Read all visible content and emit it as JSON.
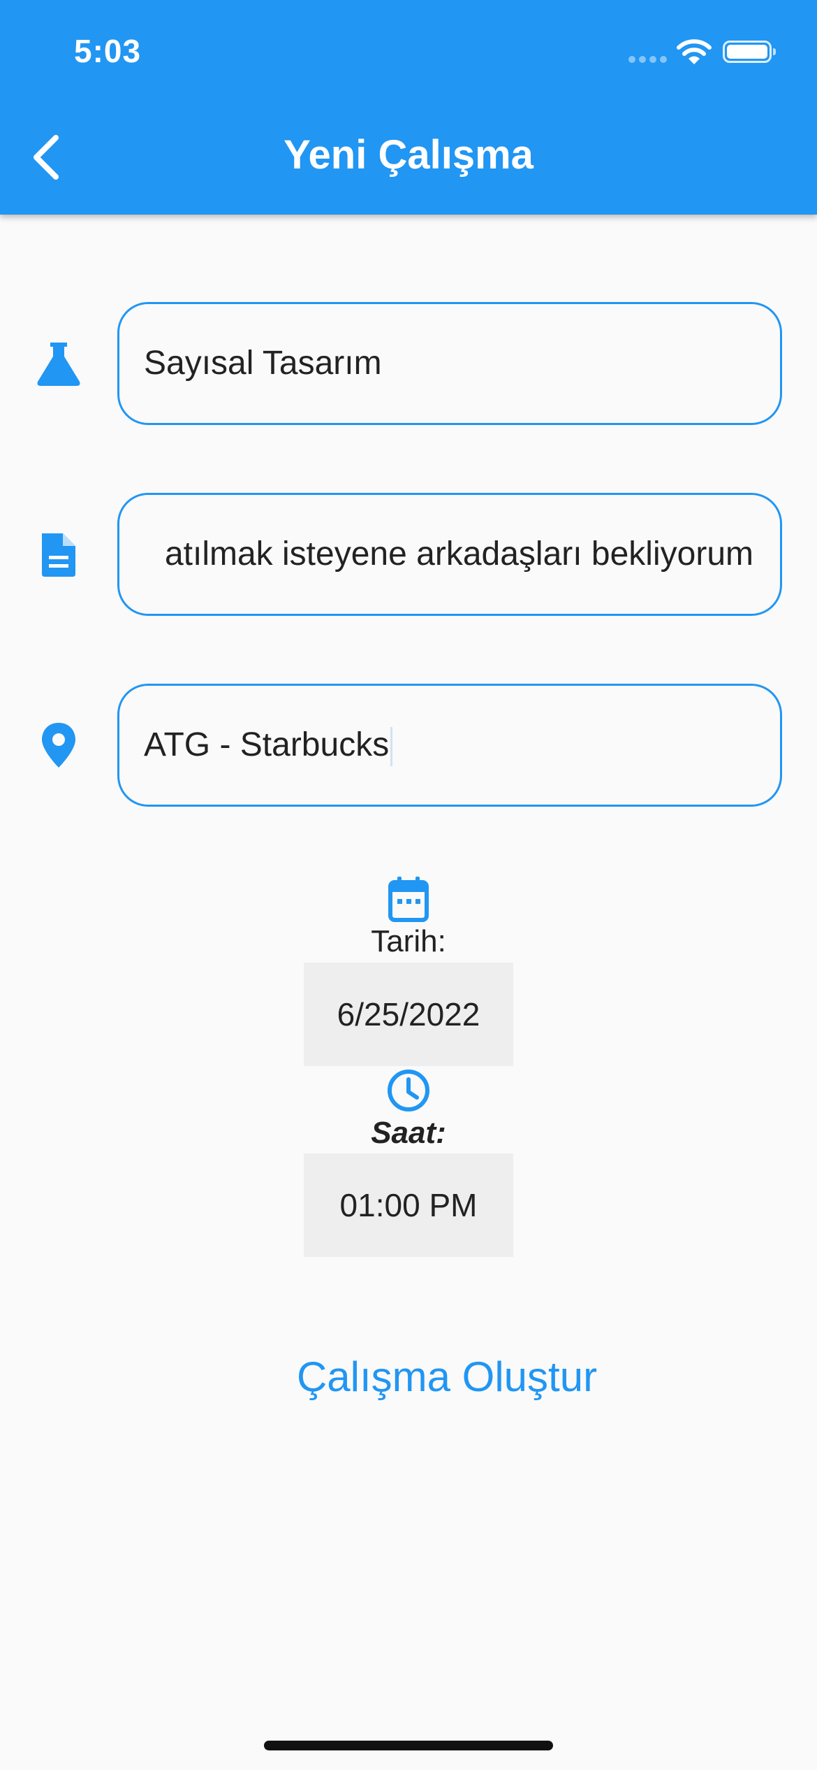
{
  "status_bar": {
    "time": "5:03"
  },
  "app_bar": {
    "title": "Yeni Çalışma",
    "back_icon": "chevron-left-icon",
    "background_color": "#2196f3"
  },
  "form": {
    "course_field": {
      "icon": "flask-icon",
      "value": "Sayısal Tasarım"
    },
    "description_field": {
      "icon": "document-icon",
      "value": "atılmak isteyene arkadaşları bekliyorum"
    },
    "location_field": {
      "icon": "location-pin-icon",
      "value": "ATG - Starbucks"
    }
  },
  "date": {
    "icon": "calendar-icon",
    "label": "Tarih:",
    "value": "6/25/2022"
  },
  "time": {
    "icon": "clock-icon",
    "label": "Saat:",
    "value": "01:00 PM"
  },
  "actions": {
    "create_label": "Çalışma Oluştur"
  },
  "accent_color": "#2196f3"
}
